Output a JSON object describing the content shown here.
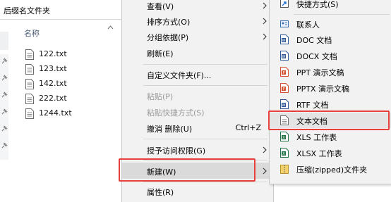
{
  "window": {
    "title": "后缀名文件夹"
  },
  "file_list": {
    "column_header": "名称",
    "files": [
      "122.txt",
      "123.txt",
      "142.txt",
      "222.txt",
      "1244.txt"
    ]
  },
  "context_menu": {
    "view": "查看(V)",
    "sort_by": "排序方式(O)",
    "group_by": "分组依据(P)",
    "refresh": "刷新(E)",
    "customize_folder": "自定义文件夹(F)...",
    "paste": "粘贴(P)",
    "paste_shortcut": "粘贴快捷方式(S)",
    "undo_delete": "撤消 删除(U)",
    "undo_shortcut": "Ctrl+Z",
    "grant_access": "授予访问权限(G)",
    "new": "新建(W)",
    "properties": "属性(R)"
  },
  "submenu": {
    "shortcut": "快捷方式(S)",
    "items": [
      "联系人",
      "DOC 文档",
      "DOCX 文档",
      "PPT 演示文稿",
      "PPTX 演示文稿",
      "RTF 文档",
      "文本文档",
      "XLS 工作表",
      "XLSX 工作表",
      "压缩(zipped)文件夹"
    ]
  },
  "colors": {
    "highlight_border": "#e8403d",
    "menu_background": "#f2f2f2",
    "hover_background": "#dadada"
  }
}
